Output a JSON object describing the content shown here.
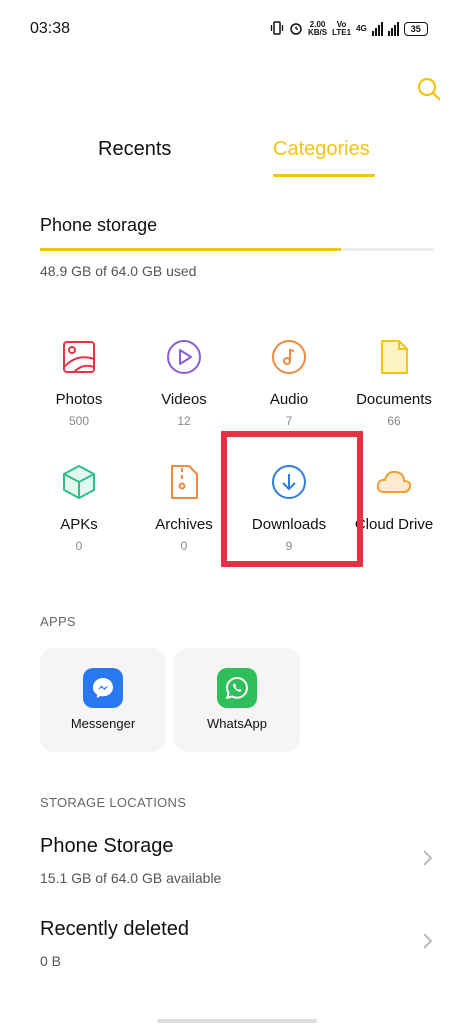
{
  "status_bar": {
    "time": "03:38",
    "speed_value": "2.00",
    "speed_unit": "KB/S",
    "volte_top": "Vo",
    "volte_bottom": "LTE1",
    "network": "4G",
    "battery": "35"
  },
  "tabs": {
    "recents": "Recents",
    "categories": "Categories",
    "active": "categories"
  },
  "storage": {
    "title": "Phone storage",
    "used_text": "48.9 GB of 64.0 GB used",
    "used_fraction": 0.764
  },
  "categories": [
    {
      "label": "Photos",
      "count": "500",
      "icon": "photos-icon",
      "color": "#e53345"
    },
    {
      "label": "Videos",
      "count": "12",
      "icon": "videos-icon",
      "color": "#8a5cd8"
    },
    {
      "label": "Audio",
      "count": "7",
      "icon": "audio-icon",
      "color": "#f08a3c"
    },
    {
      "label": "Documents",
      "count": "66",
      "icon": "documents-icon",
      "color": "#f2c413"
    },
    {
      "label": "APKs",
      "count": "0",
      "icon": "apk-icon",
      "color": "#2fbf8a"
    },
    {
      "label": "Archives",
      "count": "0",
      "icon": "archives-icon",
      "color": "#f08a3c"
    },
    {
      "label": "Downloads",
      "count": "9",
      "icon": "downloads-icon",
      "color": "#2f7fd8"
    },
    {
      "label": "Cloud Drive",
      "count": "",
      "icon": "cloud-icon",
      "color": "#f0a030"
    }
  ],
  "highlight_color": "#e53345",
  "apps": {
    "header": "APPS",
    "items": [
      {
        "label": "Messenger",
        "icon": "messenger-icon",
        "color": "#2a78f0"
      },
      {
        "label": "WhatsApp",
        "icon": "whatsapp-icon",
        "color": "#2fbf5a"
      }
    ]
  },
  "locations": {
    "header": "STORAGE LOCATIONS",
    "items": [
      {
        "title": "Phone Storage",
        "subtitle": "15.1 GB of 64.0 GB available"
      },
      {
        "title": "Recently deleted",
        "subtitle": "0 B"
      }
    ]
  },
  "accent_color": "#f2c413"
}
